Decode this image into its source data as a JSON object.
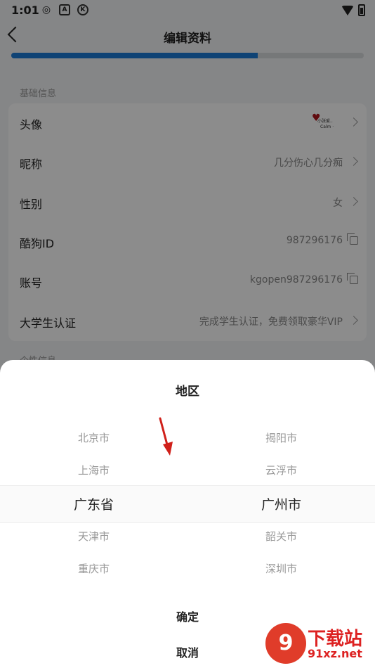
{
  "status_bar": {
    "time": "1:01",
    "icons": [
      "weibo-icon",
      "a-app-icon",
      "k-app-icon"
    ],
    "right_icons": [
      "wifi-icon",
      "battery-icon"
    ]
  },
  "header": {
    "title": "编辑资料"
  },
  "progress": {
    "fraction": 0.7
  },
  "basic_section": {
    "label": "基础信息",
    "rows": [
      {
        "label": "头像",
        "avatar_text1": "小张爱..",
        "avatar_text2": "Calm ·"
      },
      {
        "label": "昵称",
        "value": "几分伤心几分痴"
      },
      {
        "label": "性别",
        "value": "女"
      },
      {
        "label": "酷狗ID",
        "value": "987296176"
      },
      {
        "label": "账号",
        "value": "kgopen987296176"
      },
      {
        "label": "大学生认证",
        "value": "完成学生认证，免费领取豪华VIP"
      }
    ]
  },
  "personal_section": {
    "label": "个性信息"
  },
  "region_picker": {
    "title": "地区",
    "provinces": [
      "北京市",
      "上海市",
      "广东省",
      "天津市",
      "重庆市"
    ],
    "cities": [
      "揭阳市",
      "云浮市",
      "广州市",
      "韶关市",
      "深圳市"
    ],
    "selected_index": 2,
    "confirm": "确定",
    "cancel": "取消"
  },
  "watermark": {
    "logo": "9",
    "text": "下载站",
    "url": "91xz.net"
  },
  "colors": {
    "accent": "#1c7bd6",
    "arrow": "#d0201a"
  }
}
